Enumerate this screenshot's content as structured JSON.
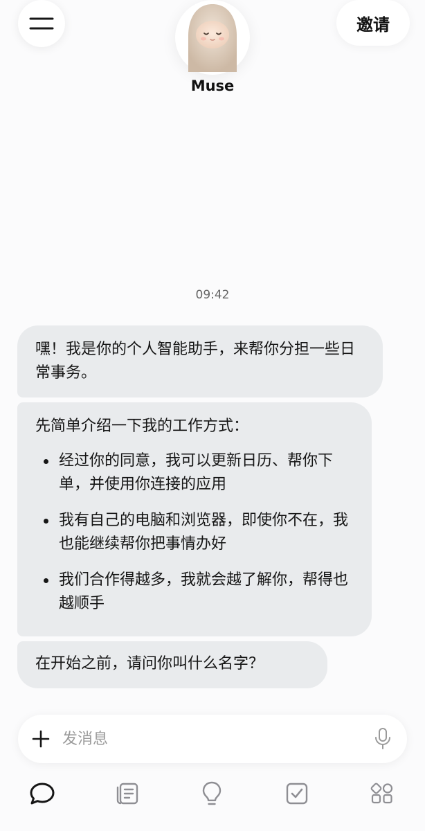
{
  "header": {
    "bot_name": "Muse",
    "invite_label": "邀请",
    "menu_icon": "menu-icon",
    "avatar": "muse-avatar"
  },
  "chat": {
    "timestamp": "09:42",
    "messages": [
      {
        "text": "嘿！我是你的个人智能助手，来帮你分担一些日常事务。"
      },
      {
        "intro": "先简单介绍一下我的工作方式：",
        "bullets": [
          "经过你的同意，我可以更新日历、帮你下单，并使用你连接的应用",
          "我有自己的电脑和浏览器，即使你不在，我也能继续帮你把事情办好",
          "我们合作得越多，我就会越了解你，帮得也越顺手"
        ]
      },
      {
        "text": "在开始之前，请问你叫什么名字？"
      }
    ]
  },
  "composer": {
    "placeholder": "发消息",
    "value": "",
    "add_icon": "plus-icon",
    "mic_icon": "microphone-icon"
  },
  "tabbar": {
    "tabs": [
      {
        "icon": "chat-bubble-icon",
        "active": true
      },
      {
        "icon": "notes-icon",
        "active": false
      },
      {
        "icon": "lightbulb-icon",
        "active": false
      },
      {
        "icon": "checkbox-icon",
        "active": false
      },
      {
        "icon": "apps-icon",
        "active": false
      }
    ],
    "active_color": "#161616",
    "inactive_color": "#8e8e93"
  },
  "colors": {
    "background": "#fbfbfc",
    "bubble": "#e9ebed",
    "text": "#161616"
  }
}
